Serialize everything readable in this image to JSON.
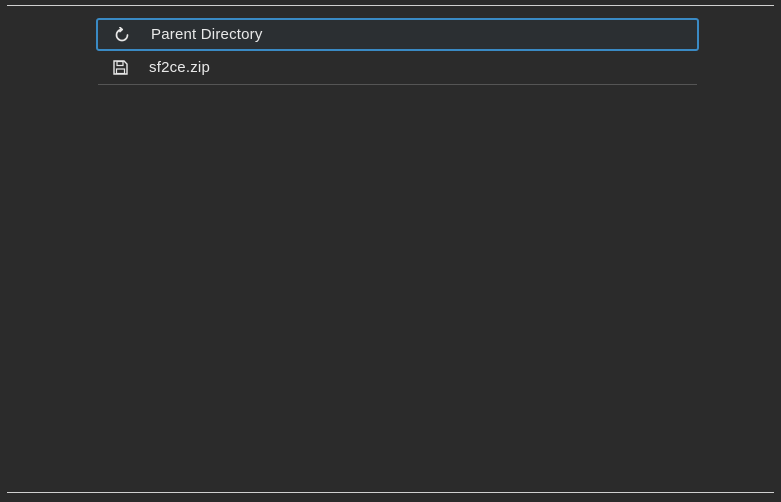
{
  "file_browser": {
    "items": [
      {
        "label": "Parent Directory",
        "icon": "back-icon",
        "selected": true
      },
      {
        "label": "sf2ce.zip",
        "icon": "save-icon",
        "selected": false
      }
    ]
  }
}
